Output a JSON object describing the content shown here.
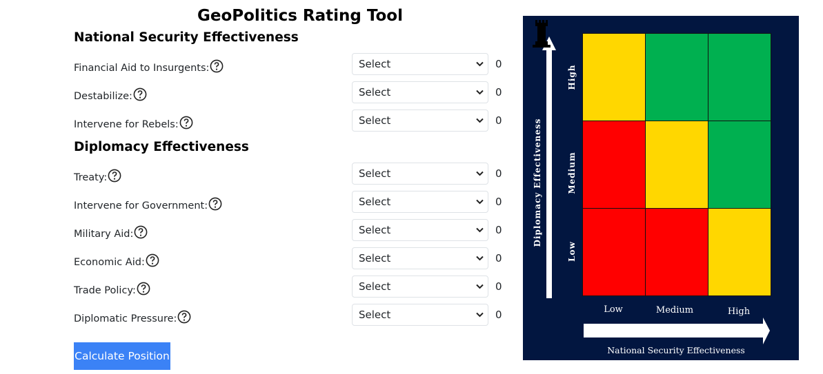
{
  "title": "GeoPolitics Rating Tool",
  "sections": [
    {
      "title": "National Security Effectiveness",
      "rows": [
        {
          "label": "Financial Aid to Insurgents:",
          "select": "Select",
          "score": "0"
        },
        {
          "label": "Destabilize:",
          "select": "Select",
          "score": "0"
        },
        {
          "label": "Intervene for Rebels:",
          "select": "Select",
          "score": "0"
        }
      ]
    },
    {
      "title": "Diplomacy Effectiveness",
      "rows": [
        {
          "label": "Treaty:",
          "select": "Select",
          "score": "0"
        },
        {
          "label": "Intervene for Government:",
          "select": "Select",
          "score": "0"
        },
        {
          "label": "Military Aid:",
          "select": "Select",
          "score": "0"
        },
        {
          "label": "Economic Aid:",
          "select": "Select",
          "score": "0"
        },
        {
          "label": "Trade Policy:",
          "select": "Select",
          "score": "0"
        },
        {
          "label": "Diplomatic Pressure:",
          "select": "Select",
          "score": "0"
        }
      ]
    }
  ],
  "calculate_label": "Calculate Position",
  "matrix": {
    "y_axis_title": "Diplomacy Effectiveness",
    "x_axis_title": "National Security  Effectiveness",
    "y_levels": [
      "High",
      "Medium",
      "Low"
    ],
    "x_levels": [
      "Low",
      "Medium",
      "High"
    ],
    "cells": [
      [
        "yellow",
        "green",
        "green"
      ],
      [
        "red",
        "yellow",
        "green"
      ],
      [
        "red",
        "red",
        "yellow"
      ]
    ],
    "colors": {
      "panel": "#021640",
      "red": "#ff0000",
      "yellow": "#ffd700",
      "green": "#00b050",
      "button": "#3b82f6"
    },
    "marker_icon": "chess-rook-icon"
  }
}
